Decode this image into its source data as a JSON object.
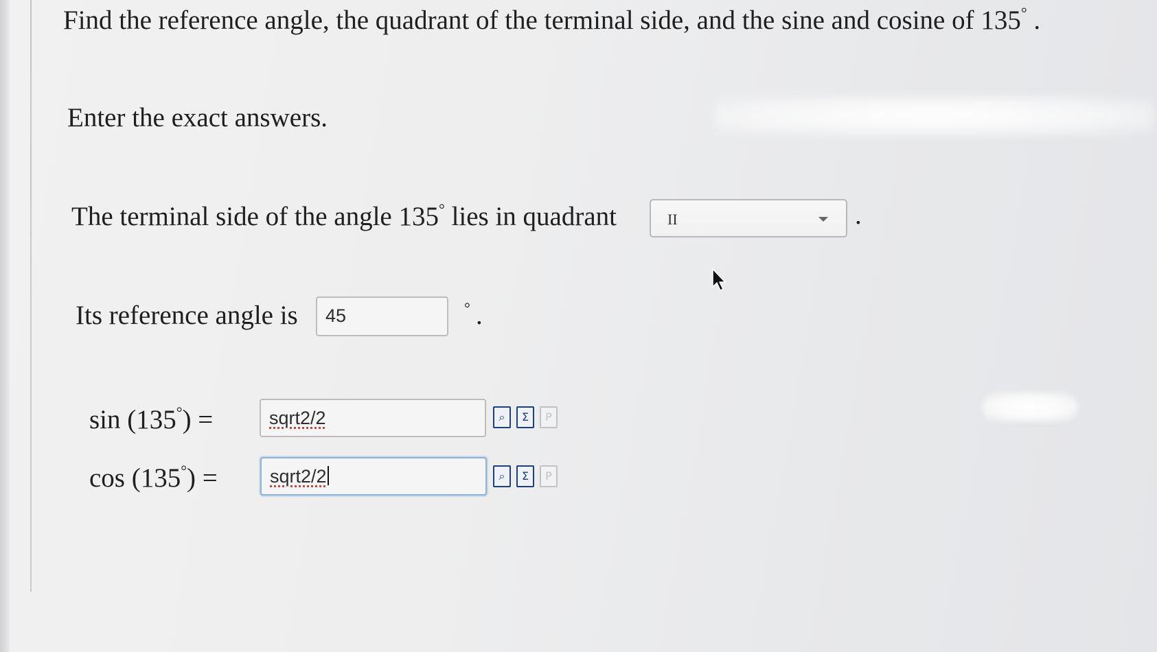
{
  "question": {
    "text": "Find the reference angle, the quadrant of the terminal side, and the sine and cosine of 135",
    "end": "."
  },
  "instruction": "Enter the exact answers.",
  "quadrant": {
    "prefix": "The terminal side of the angle 135",
    "suffix": " lies in quadrant",
    "selected": "II",
    "period": "."
  },
  "reference_angle": {
    "label": "Its reference angle is",
    "value": "45",
    "degree_symbol": "°",
    "period": "."
  },
  "sin": {
    "label": "sin (135",
    "label_end": ") =",
    "value": "sqrt2/2"
  },
  "cos": {
    "label": "cos (135",
    "label_end": ") =",
    "value": "sqrt2/2"
  },
  "degree": "°",
  "tools": {
    "preview": "⌕",
    "equation_editor": "Σ",
    "paste": "P"
  },
  "colors": {
    "tool_icon": "#1f3f7a",
    "focus_border": "#8eb2d6",
    "background": "#eeeeef"
  }
}
